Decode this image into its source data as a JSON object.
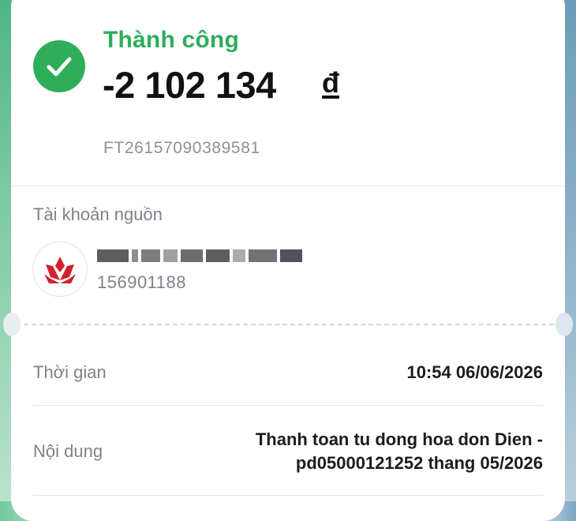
{
  "status": {
    "text": "Thành công",
    "icon": "check-circle-icon",
    "color": "#2eae5b"
  },
  "transaction": {
    "amount": "-2 102 134",
    "currency": "đ",
    "reference": "FT26157090389581"
  },
  "source_account": {
    "label": "Tài khoản nguồn",
    "bank_logo": "bank-logo-icon",
    "account_name_masked": "HỌ TÊN",
    "account_number": "156901188"
  },
  "details": {
    "time_label": "Thời gian",
    "time_value": "10:54 06/06/2026",
    "content_label": "Nội dung",
    "content_line1": "Thanh toan tu dong hoa don Dien -",
    "content_line2": "pd05000121252 thang 05/2026"
  }
}
